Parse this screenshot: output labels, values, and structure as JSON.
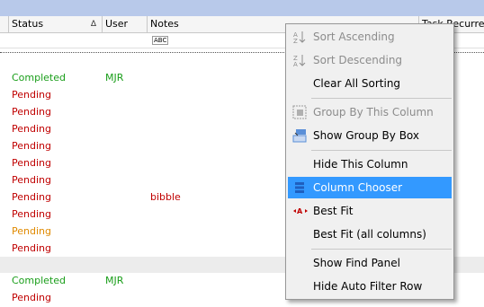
{
  "columns": [
    {
      "label": "Status",
      "sort": "Δ"
    },
    {
      "label": "User"
    },
    {
      "label": "Notes"
    },
    {
      "label": "Task Recurren"
    }
  ],
  "filter": {
    "abc_glyph": "ABC"
  },
  "rows": [
    {
      "status": "Completed",
      "user": "MJR",
      "notes": "",
      "color": "#1a9e1a"
    },
    {
      "status": "Pending",
      "user": "",
      "notes": "",
      "color": "#c00000"
    },
    {
      "status": "Pending",
      "user": "",
      "notes": "",
      "color": "#c00000"
    },
    {
      "status": "Pending",
      "user": "",
      "notes": "",
      "color": "#c00000"
    },
    {
      "status": "Pending",
      "user": "",
      "notes": "",
      "color": "#c00000"
    },
    {
      "status": "Pending",
      "user": "",
      "notes": "",
      "color": "#c00000"
    },
    {
      "status": "Pending",
      "user": "",
      "notes": "",
      "color": "#c00000"
    },
    {
      "status": "Pending",
      "user": "",
      "notes": "bibble",
      "color": "#c00000"
    },
    {
      "status": "Pending",
      "user": "",
      "notes": "",
      "color": "#c00000"
    },
    {
      "status": "Pending",
      "user": "",
      "notes": "",
      "color": "#e08a00"
    },
    {
      "status": "Pending",
      "user": "",
      "notes": "",
      "color": "#c00000"
    }
  ],
  "group2": [
    {
      "status": "Completed",
      "user": "MJR",
      "color": "#1a9e1a"
    },
    {
      "status": "Pending",
      "user": "",
      "color": "#c00000"
    }
  ],
  "menu": {
    "items": [
      {
        "label": "Sort Ascending",
        "icon": "sort-ascending-icon",
        "disabled": true
      },
      {
        "label": "Sort Descending",
        "icon": "sort-descending-icon",
        "disabled": true
      },
      {
        "label": "Clear All Sorting"
      },
      {
        "label": "Group By This Column",
        "icon": "group-by-icon",
        "disabled": true
      },
      {
        "label": "Show Group By Box",
        "icon": "group-box-icon"
      },
      {
        "label": "Hide This Column"
      },
      {
        "label": "Column Chooser",
        "icon": "column-chooser-icon",
        "highlighted": true
      },
      {
        "label": "Best Fit",
        "icon": "best-fit-icon"
      },
      {
        "label": "Best Fit (all columns)"
      },
      {
        "label": "Show Find Panel"
      },
      {
        "label": "Hide Auto Filter Row"
      }
    ]
  }
}
